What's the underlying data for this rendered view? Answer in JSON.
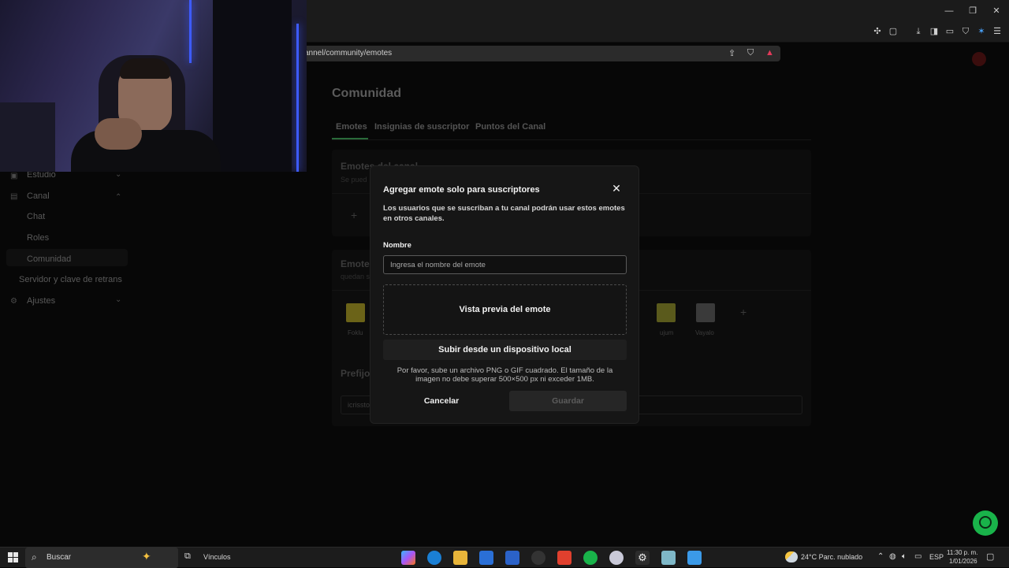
{
  "browser": {
    "url": "annel/community/emotes"
  },
  "page": {
    "title": "Comunidad",
    "tabs": [
      {
        "label": "Emotes"
      },
      {
        "label": "Insignias de suscriptor"
      },
      {
        "label": "Puntos del Canal"
      }
    ],
    "emotes_section_title": "Emotes del canal",
    "emotes_section_sub": "Se pued",
    "sub_section_title": "Emote",
    "sub_section_sub": "quedan s",
    "emote_items": [
      {
        "label": "Foklu"
      },
      {
        "label": "ujum"
      },
      {
        "label": "Vayalo"
      }
    ],
    "prefix_title": "Prefijo",
    "prefix_value": "icrissto"
  },
  "sidebar": {
    "items": [
      {
        "label": "Estudio",
        "icon": "studio-icon"
      },
      {
        "label": "Canal",
        "icon": "channel-icon"
      },
      {
        "label": "Chat"
      },
      {
        "label": "Roles"
      },
      {
        "label": "Comunidad"
      },
      {
        "label": "Servidor y clave de retrans"
      },
      {
        "label": "Ajustes",
        "icon": "gear-icon"
      }
    ]
  },
  "modal": {
    "title": "Agregar emote solo para suscriptores",
    "description": "Los usuarios que se suscriban a tu canal podrán usar estos emotes en otros canales.",
    "name_label": "Nombre",
    "name_placeholder": "Ingresa el nombre del emote",
    "name_value": "",
    "preview_label": "Vista previa del emote",
    "upload_label": "Subir desde un dispositivo local",
    "help_text": "Por favor, sube un archivo PNG o GIF cuadrado. El tamaño de la imagen no debe superar 500×500 px ni exceder 1MB.",
    "cancel_label": "Cancelar",
    "save_label": "Guardar"
  },
  "taskbar": {
    "search_placeholder": "Buscar",
    "links_label": "Vínculos",
    "weather": "24°C  Parc. nublado",
    "language": "ESP",
    "time": "11:30 p. m.",
    "date": "1/01/2026"
  },
  "colors": {
    "accent_green": "#19b34a",
    "modal_bg": "#161616",
    "page_bg": "#070707"
  }
}
